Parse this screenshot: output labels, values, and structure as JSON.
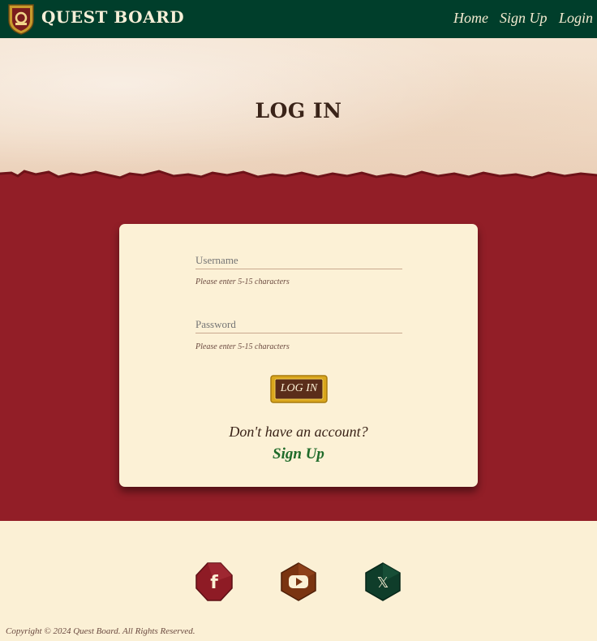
{
  "brand": {
    "name": "QUEST BOARD",
    "logo_icon": "shield-logo-icon"
  },
  "nav": {
    "links": [
      {
        "label": "Home"
      },
      {
        "label": "Sign Up"
      },
      {
        "label": "Login"
      }
    ]
  },
  "hero": {
    "title": "LOG IN"
  },
  "form": {
    "username": {
      "placeholder": "Username",
      "value": "",
      "helper": "Please enter 5-15 characters"
    },
    "password": {
      "placeholder": "Password",
      "value": "",
      "helper": "Please enter 5-15 characters"
    },
    "submit_label": "LOG IN",
    "no_account_text": "Don't have an account?",
    "signup_label": "Sign Up"
  },
  "footer": {
    "socials": [
      {
        "icon": "facebook-icon",
        "glyph": "f",
        "color": "#8e1b25"
      },
      {
        "icon": "youtube-icon",
        "glyph": "▶",
        "color": "#7a3411"
      },
      {
        "icon": "x-twitter-icon",
        "glyph": "𝕏",
        "color": "#0f3d2a"
      }
    ],
    "copyright": "Copyright © 2024 Quest Board. All Rights Reserved."
  },
  "colors": {
    "nav_bg": "#003e2b",
    "band_red": "#921e27",
    "card_bg": "#fcf1d6",
    "link_green": "#1f6b2a",
    "button_gold": "#d9a61c",
    "button_brown": "#5a2d1a"
  }
}
